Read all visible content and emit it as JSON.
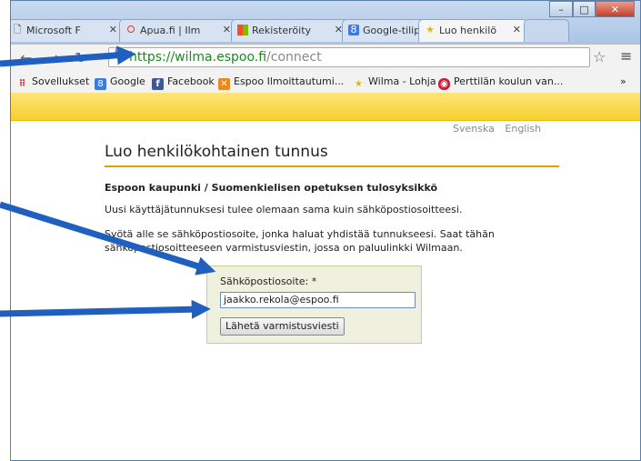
{
  "browser": {
    "tabs": [
      {
        "label": "Microsoft F",
        "icon": "document-icon"
      },
      {
        "label": "Apua.fi | Ilm",
        "icon": "apua-icon"
      },
      {
        "label": "Rekisteröity",
        "icon": "microsoft-icon"
      },
      {
        "label": "Google-tilip",
        "icon": "google-icon"
      },
      {
        "label": "Luo henkilö",
        "icon": "wilma-star-icon"
      }
    ],
    "url_host": "https://wilma.espoo.fi",
    "url_path": "/connect",
    "bookmarks": [
      {
        "label": "Sovellukset",
        "icon": "apps-icon"
      },
      {
        "label": "Google",
        "icon": "google-icon"
      },
      {
        "label": "Facebook",
        "icon": "facebook-icon"
      },
      {
        "label": "Espoo Ilmoittautumi...",
        "icon": "espoo-icon"
      },
      {
        "label": "Wilma - Lohja",
        "icon": "wilma-star-icon"
      },
      {
        "label": "Perttilän koulun van...",
        "icon": "school-icon"
      }
    ],
    "more_bookmarks": "»"
  },
  "page": {
    "languages": [
      "Svenska",
      "English"
    ],
    "title": "Luo henkilökohtainen tunnus",
    "organization": "Espoon kaupunki / Suomenkielisen opetuksen tulosyksikkö",
    "info": "Uusi käyttäjätunnuksesi tulee olemaan sama kuin sähköpostiosoitteesi.",
    "instructions": "Syötä alle se sähköpostiosoite, jonka haluat yhdistää tunnukseesi. Saat tähän sähköpostiosoitteeseen varmistusviestin, jossa on paluulinkki Wilmaan.",
    "form": {
      "email_label": "Sähköpostiosoite: *",
      "email_value": "jaakko.rekola@espoo.fi",
      "submit_label": "Lähetä varmistusviesti"
    }
  },
  "colors": {
    "accent_yellow": "#f7cf2e",
    "url_green": "#1a8a1a",
    "annotation_arrow": "#1f5fbf"
  }
}
